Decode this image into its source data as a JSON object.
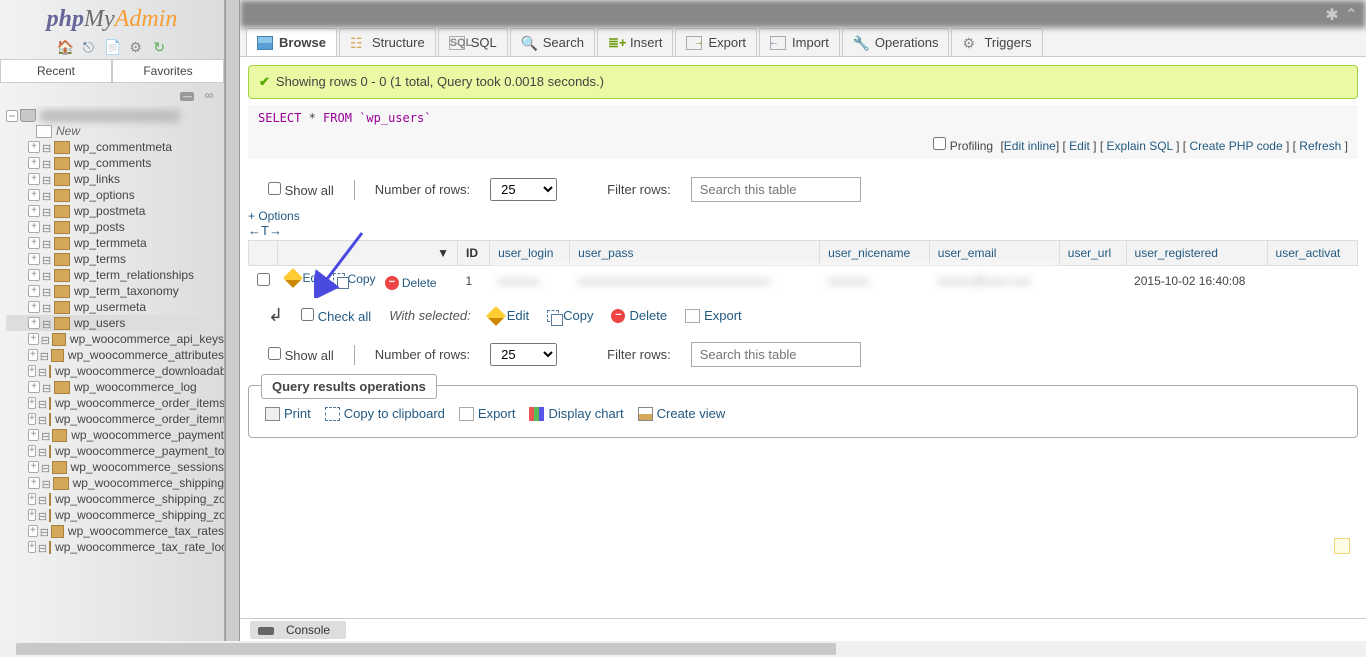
{
  "logo": {
    "php": "php",
    "my": "My",
    "admin": "Admin"
  },
  "sidebar_tabs": {
    "recent": "Recent",
    "favorites": "Favorites"
  },
  "tree_new": "New",
  "tables": [
    "wp_commentmeta",
    "wp_comments",
    "wp_links",
    "wp_options",
    "wp_postmeta",
    "wp_posts",
    "wp_termmeta",
    "wp_terms",
    "wp_term_relationships",
    "wp_term_taxonomy",
    "wp_usermeta",
    "wp_users",
    "wp_woocommerce_api_keys",
    "wp_woocommerce_attributes",
    "wp_woocommerce_downloadable",
    "wp_woocommerce_log",
    "wp_woocommerce_order_items",
    "wp_woocommerce_order_itemmeta",
    "wp_woocommerce_payment",
    "wp_woocommerce_payment_tokens",
    "wp_woocommerce_sessions",
    "wp_woocommerce_shipping",
    "wp_woocommerce_shipping_zone",
    "wp_woocommerce_shipping_zones",
    "wp_woocommerce_tax_rates",
    "wp_woocommerce_tax_rate_locations"
  ],
  "selected_table": "wp_users",
  "tabs": {
    "browse": "Browse",
    "structure": "Structure",
    "sql": "SQL",
    "search": "Search",
    "insert": "Insert",
    "export": "Export",
    "import": "Import",
    "operations": "Operations",
    "triggers": "Triggers"
  },
  "success_msg": "Showing rows 0 - 0 (1 total, Query took 0.0018 seconds.)",
  "sql_query": {
    "select": "SELECT",
    "star": " * ",
    "from": "FROM",
    "table": "`wp_users`"
  },
  "profiling": {
    "label": "Profiling",
    "edit_inline": "Edit inline",
    "edit": "Edit",
    "explain": "Explain SQL",
    "create_php": "Create PHP code",
    "refresh": "Refresh"
  },
  "filter": {
    "show_all": "Show all",
    "num_rows": "Number of rows:",
    "rows_value": "25",
    "filter_rows": "Filter rows:",
    "placeholder": "Search this table"
  },
  "options_link": "+ Options",
  "sort_arrows": "←T→",
  "columns": [
    "ID",
    "user_login",
    "user_pass",
    "user_nicename",
    "user_email",
    "user_url",
    "user_registered",
    "user_activat"
  ],
  "row": {
    "edit": "Edit",
    "copy": "Copy",
    "delete": "Delete",
    "id": "1",
    "registered": "2015-10-02 16:40:08"
  },
  "bulk": {
    "check_all": "Check all",
    "with_selected": "With selected:",
    "edit": "Edit",
    "copy": "Copy",
    "delete": "Delete",
    "export": "Export"
  },
  "ops": {
    "legend": "Query results operations",
    "print": "Print",
    "copy_clip": "Copy to clipboard",
    "export": "Export",
    "display_chart": "Display chart",
    "create_view": "Create view"
  },
  "console": "Console"
}
